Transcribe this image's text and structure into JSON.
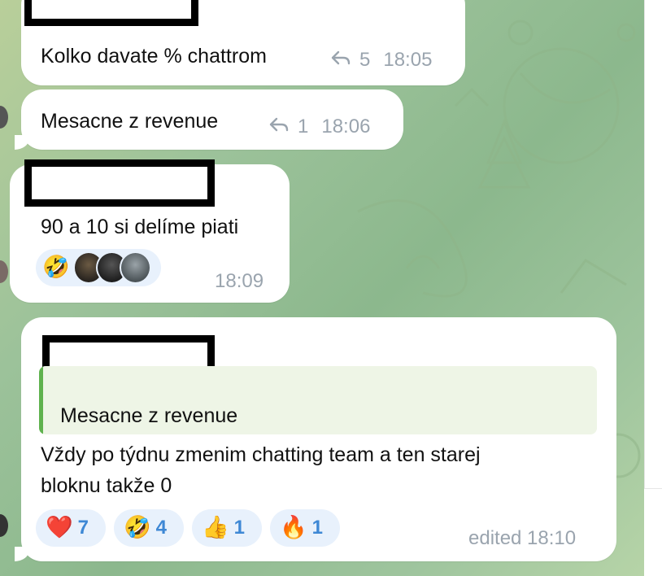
{
  "colors": {
    "bubble": "#ffffff",
    "meta": "#9aa4ae",
    "reaction_bg": "#e8f1fc",
    "reaction_count": "#3e88d5",
    "quote_bar": "#5fb24e",
    "quote_bg": "#eef5e6"
  },
  "messages": [
    {
      "sender_redacted": true,
      "text": "Kolko davate % chattrom",
      "replies": "5",
      "time": "18:05"
    },
    {
      "text": "Mesacne z revenue",
      "replies": "1",
      "time": "18:06"
    },
    {
      "sender_redacted": true,
      "text": "90 a 10 si delíme piati",
      "reaction_emoji": "🤣",
      "reactor_avatars": [
        "avatar",
        "avatar",
        "avatar"
      ],
      "time": "18:09"
    },
    {
      "sender_redacted": true,
      "quote_text": "Mesacne z revenue",
      "text_line1": "Vždy po týdnu zmenim chatting team a ten starej",
      "text_line2": "bloknu takže 0",
      "reactions": [
        {
          "emoji": "❤️",
          "count": "7"
        },
        {
          "emoji": "🤣",
          "count": "4"
        },
        {
          "emoji": "👍",
          "count": "1"
        },
        {
          "emoji": "🔥",
          "count": "1"
        }
      ],
      "time": "edited 18:10"
    }
  ]
}
